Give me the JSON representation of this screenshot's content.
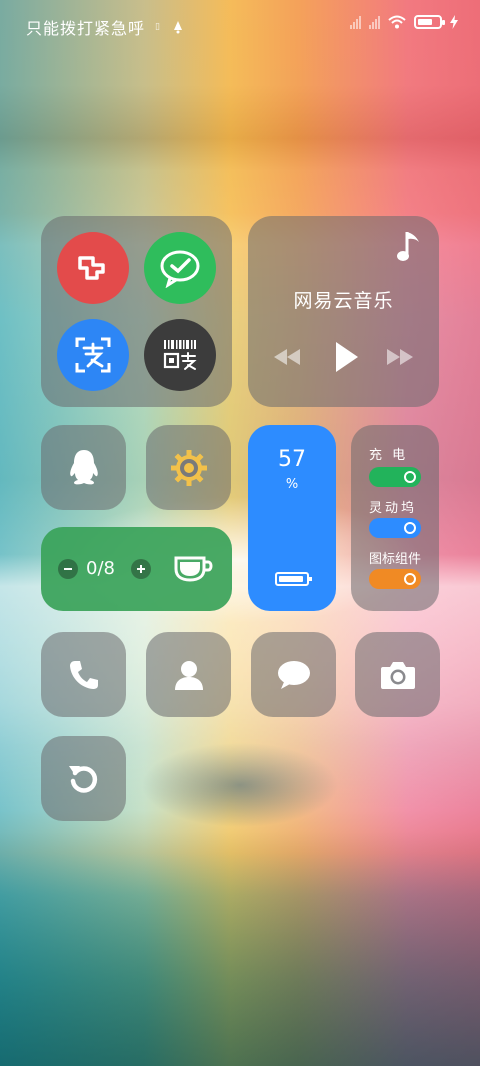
{
  "status_bar": {
    "carrier_text": "只能拨打紧急呼",
    "battery_level": 0.7
  },
  "quick_apps": [
    {
      "name": "red-app",
      "color": "#e34b4b"
    },
    {
      "name": "wechat",
      "color": "#2fbd5c"
    },
    {
      "name": "alipay-scan",
      "color": "#2d86f5"
    },
    {
      "name": "alipay-pay-code",
      "color": "#3c3c3c"
    }
  ],
  "music": {
    "title": "网易云音乐"
  },
  "battery_widget": {
    "percent": "57",
    "unit": "%",
    "bg_color": "#2d8cff"
  },
  "toggles": {
    "items": [
      {
        "label": "充 电",
        "color": "#22b35b",
        "on": true
      },
      {
        "label": "灵动坞",
        "color": "#2d8cff",
        "on": true
      },
      {
        "label": "图标组件",
        "color": "#f08a24",
        "on": true
      }
    ]
  },
  "water": {
    "count": "0/8",
    "bg_color": "#3aa35a"
  },
  "dock": {
    "icons": [
      "phone-icon",
      "contacts-icon",
      "messages-icon",
      "camera-icon",
      "refresh-icon"
    ]
  }
}
